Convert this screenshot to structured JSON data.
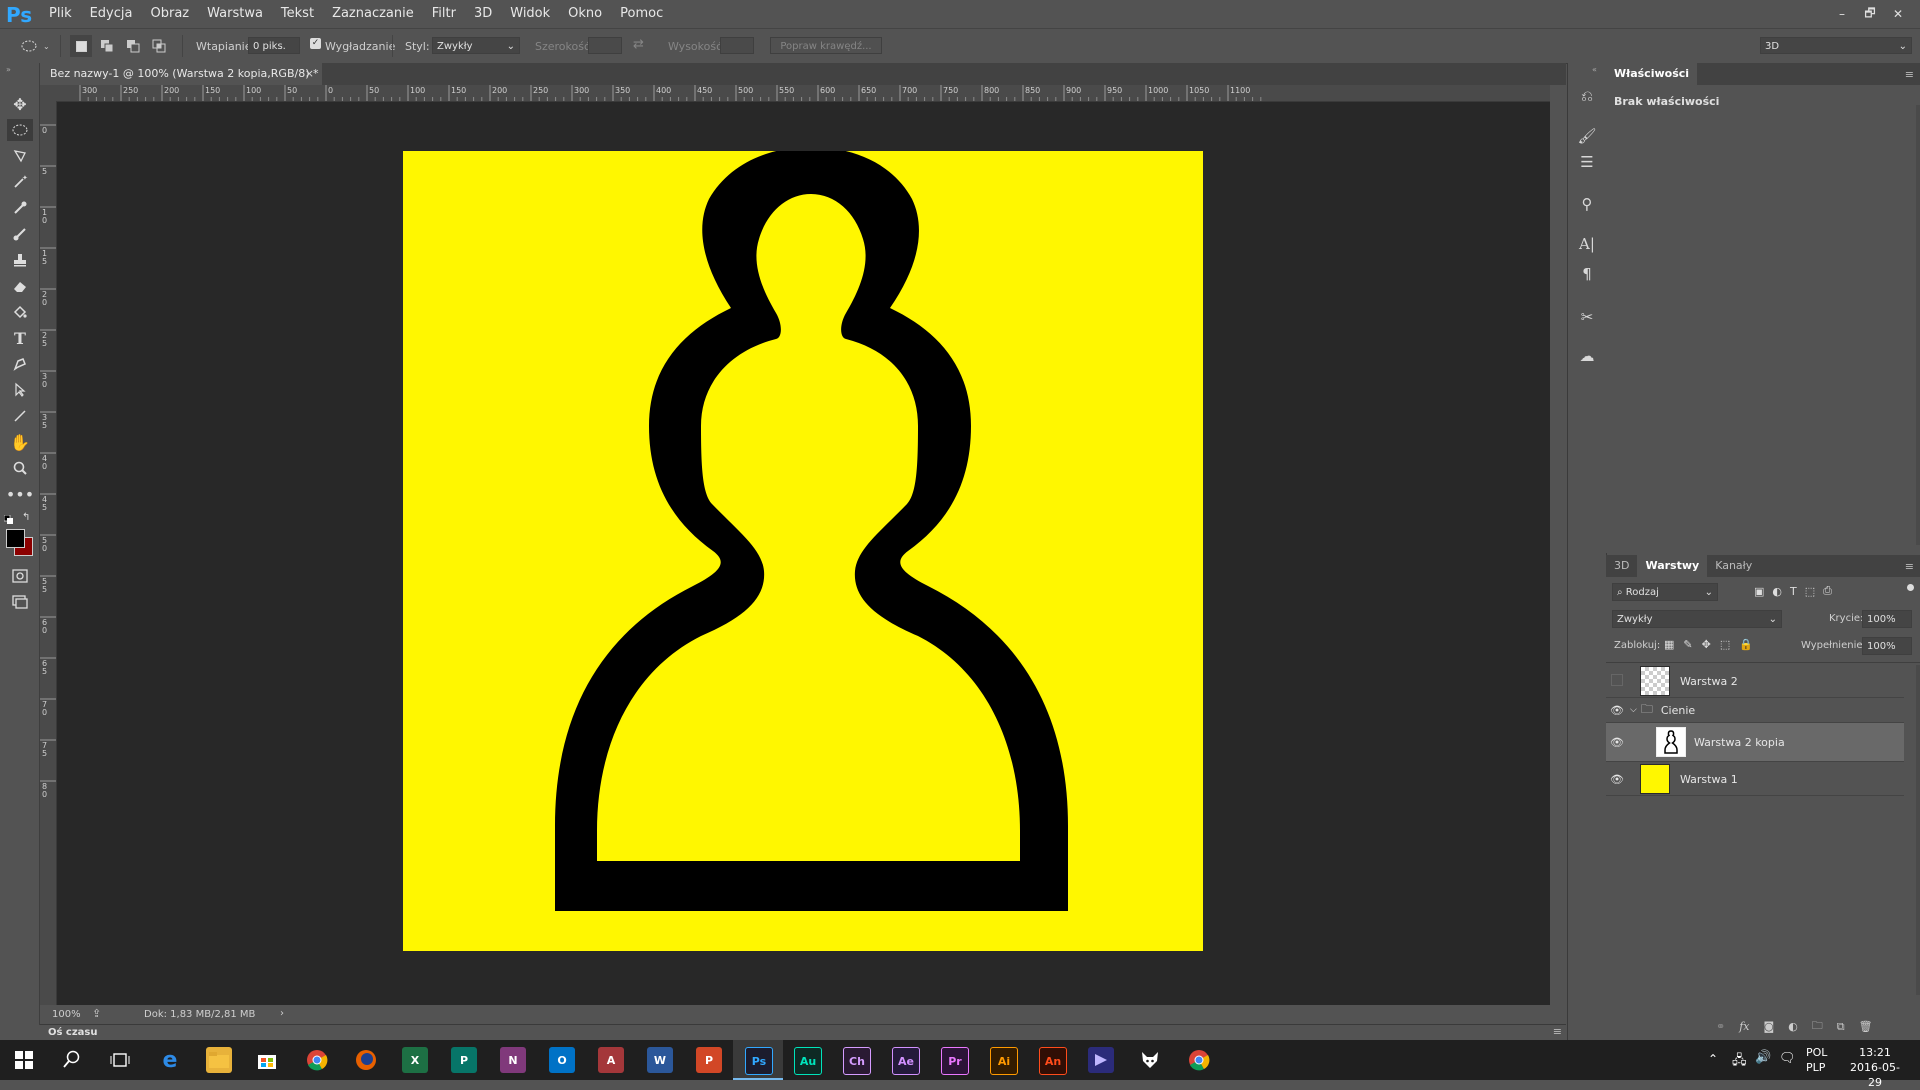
{
  "app": {
    "logo": "Ps",
    "menu": [
      "Plik",
      "Edycja",
      "Obraz",
      "Warstwa",
      "Tekst",
      "Zaznaczanie",
      "Filtr",
      "3D",
      "Widok",
      "Okno",
      "Pomoc"
    ],
    "window_controls": [
      "–",
      "🗗",
      "✕"
    ]
  },
  "options": {
    "feather_label": "Wtapianie:",
    "feather_value": "0 piks.",
    "antialias_label": "Wygładzanie",
    "antialias_checked": true,
    "style_label": "Styl:",
    "style_value": "Zwykły",
    "width_label": "Szerokość:",
    "height_label": "Wysokość:",
    "refine_label": "Popraw krawędź...",
    "workspace_value": "3D"
  },
  "document": {
    "tab_title": "Bez nazwy-1 @ 100% (Warstwa 2 kopia,RGB/8) *",
    "close_glyph": "×",
    "zoom": "100%",
    "doc_info": "Dok: 1,83 MB/2,81 MB",
    "timeline_label": "Oś czasu",
    "canvas_color": "#fff700"
  },
  "ruler": {
    "top_ticks": [
      "300",
      "250",
      "200",
      "150",
      "100",
      "50",
      "0",
      "50",
      "100",
      "150",
      "200",
      "250",
      "300",
      "350",
      "400",
      "450",
      "500",
      "550",
      "600",
      "650",
      "700",
      "750",
      "800",
      "850",
      "900",
      "950",
      "1000",
      "1050",
      "1100"
    ],
    "left_ticks": [
      "5",
      "0",
      "5",
      "1 0",
      "1 5",
      "2 0",
      "2 5",
      "3 0",
      "3 5",
      "4 0",
      "4 5",
      "5 0",
      "5 5",
      "6 0",
      "6 5",
      "7 0",
      "7 5",
      "8 0"
    ]
  },
  "properties": {
    "tab": "Właściwości",
    "empty_text": "Brak właściwości"
  },
  "layers_panel": {
    "tabs": [
      "3D",
      "Warstwy",
      "Kanały"
    ],
    "active_tab": "Warstwy",
    "filter_value": "Rodzaj",
    "blend_mode": "Zwykły",
    "opacity_label": "Krycie:",
    "opacity_value": "100%",
    "lock_label": "Zablokuj:",
    "fill_label": "Wypełnienie:",
    "fill_value": "100%",
    "layers": [
      {
        "name": "Warstwa 2",
        "visible": false,
        "thumb": "transparent"
      },
      {
        "name": "Cienie",
        "visible": true,
        "thumb": "group"
      },
      {
        "name": "Warstwa 2 kopia",
        "visible": true,
        "thumb": "pawn",
        "selected": true
      },
      {
        "name": "Warstwa 1",
        "visible": true,
        "thumb": "yellow"
      }
    ],
    "footer_icons": [
      "link-icon",
      "fx-icon",
      "mask-icon",
      "adjustment-icon",
      "folder-icon",
      "new-layer-icon",
      "trash-icon"
    ]
  },
  "taskbar": {
    "language": "POL",
    "language2": "PLP",
    "time": "13:21",
    "date": "2016-05-29",
    "apps": [
      "X",
      "P",
      "N",
      "O",
      "A",
      "W",
      "P",
      "Ps",
      "Au",
      "Ch",
      "Ae",
      "Pr",
      "Ai",
      "An"
    ]
  },
  "colors": {
    "accent": "#31a8ff",
    "foreground": "#000000",
    "background": "#8b0000"
  }
}
